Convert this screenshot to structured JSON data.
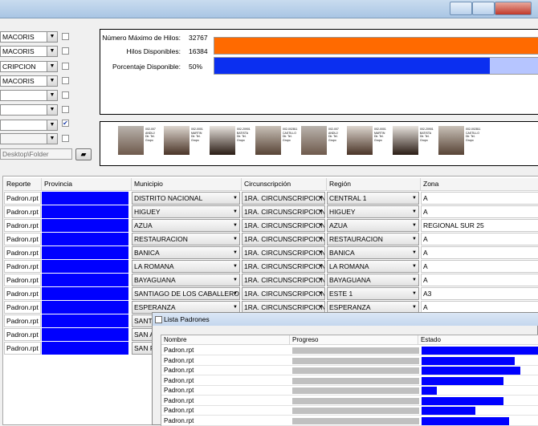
{
  "left_panel": {
    "combos": [
      "MACORIS",
      "MACORIS",
      "CRIPCION",
      "MACORIS",
      "",
      "",
      "",
      ""
    ],
    "checkbox_checked": [
      false,
      false,
      false,
      false,
      false,
      false,
      true,
      false
    ],
    "folder_path": "Desktop\\Folder"
  },
  "stats": {
    "max_label": "Número Máximo de Hilos:",
    "max_value": "32767",
    "avail_label": "Hilos Disponibles:",
    "avail_value": "16384",
    "pct_label": "Porcentaje Disponible:",
    "pct_value": "50%",
    "max_fill": 1.0,
    "avail_fill": 0.82,
    "colors": {
      "orange": "#ff6a00",
      "blue": "#0b2ff0",
      "light_blue": "#b6c5ff"
    }
  },
  "photo_cards": [
    {
      "id": "002-007",
      "name": "ANDUJ",
      "extra": "Dir. Tel. Grupo"
    },
    {
      "id": "002-0001",
      "name": "MARTIN",
      "extra": "Dir. Tel. Grupo"
    },
    {
      "id": "002-20901",
      "name": "BATISTA",
      "extra": "Dir. Tel. Grupo"
    },
    {
      "id": "002-002811",
      "name": "CASTILLO",
      "extra": "Dir. Tel. Grupo"
    },
    {
      "id": "002-007",
      "name": "ANDUJ",
      "extra": "Dir. Tel. Grupo"
    },
    {
      "id": "002-0001",
      "name": "MARTIN",
      "extra": "Dir. Tel. Grupo"
    },
    {
      "id": "002-20901",
      "name": "BATISTA",
      "extra": "Dir. Tel. Grupo"
    },
    {
      "id": "002-002811",
      "name": "CASTILLO",
      "extra": "Dir. Tel. Grupo"
    }
  ],
  "grid": {
    "headers": [
      "Reporte",
      "Provincia",
      "Municipio",
      "Circunscripción",
      "Región",
      "Zona"
    ],
    "rows": [
      {
        "reporte": "Padron.rpt",
        "municipio": "DISTRITO NACIONAL",
        "circ": "1RA. CIRCUNSCRIPCION",
        "region": "CENTRAL 1",
        "zona": "A"
      },
      {
        "reporte": "Padron.rpt",
        "municipio": "HIGUEY",
        "circ": "1RA. CIRCUNSCRIPCION",
        "region": "HIGUEY",
        "zona": "A"
      },
      {
        "reporte": "Padron.rpt",
        "municipio": "AZUA",
        "circ": "1RA. CIRCUNSCRIPCION",
        "region": "AZUA",
        "zona": "REGIONAL SUR 25"
      },
      {
        "reporte": "Padron.rpt",
        "municipio": "RESTAURACION",
        "circ": "1RA. CIRCUNSCRIPCION",
        "region": "RESTAURACION",
        "zona": "A"
      },
      {
        "reporte": "Padron.rpt",
        "municipio": "BANICA",
        "circ": "1RA. CIRCUNSCRIPCION",
        "region": "BANICA",
        "zona": "A"
      },
      {
        "reporte": "Padron.rpt",
        "municipio": "LA ROMANA",
        "circ": "1RA. CIRCUNSCRIPCION",
        "region": "LA ROMANA",
        "zona": "A"
      },
      {
        "reporte": "Padron.rpt",
        "municipio": "BAYAGUANA",
        "circ": "1RA. CIRCUNSCRIPCION",
        "region": "BAYAGUANA",
        "zona": "A"
      },
      {
        "reporte": "Padron.rpt",
        "municipio": "SANTIAGO DE LOS CABALLEROS",
        "circ": "1RA. CIRCUNSCRIPCION",
        "region": "ESTE 1",
        "zona": "A3"
      },
      {
        "reporte": "Padron.rpt",
        "municipio": "ESPERANZA",
        "circ": "1RA. CIRCUNSCRIPCION",
        "region": "ESPERANZA",
        "zona": "A"
      },
      {
        "reporte": "Padron.rpt",
        "municipio": "SANTO",
        "circ": "",
        "region": "",
        "zona": ""
      },
      {
        "reporte": "Padron.rpt",
        "municipio": "SAN A",
        "circ": "",
        "region": "",
        "zona": ""
      },
      {
        "reporte": "Padron.rpt",
        "municipio": "SAN P",
        "circ": "",
        "region": "",
        "zona": ""
      }
    ]
  },
  "popup": {
    "title": "Lista Padrones",
    "headers": [
      "Nombre",
      "Progreso",
      "Estado"
    ],
    "rows": [
      {
        "nombre": "Padron.rpt",
        "estado": 1.0
      },
      {
        "nombre": "Padron.rpt",
        "estado": 0.8
      },
      {
        "nombre": "Padron.rpt",
        "estado": 0.85
      },
      {
        "nombre": "Padron.rpt",
        "estado": 0.7
      },
      {
        "nombre": "Padron.rpt",
        "estado": 0.13
      },
      {
        "nombre": "Padron.rpt",
        "estado": 0.7
      },
      {
        "nombre": "Padron.rpt",
        "estado": 0.46
      },
      {
        "nombre": "Padron.rpt",
        "estado": 0.75
      }
    ]
  }
}
